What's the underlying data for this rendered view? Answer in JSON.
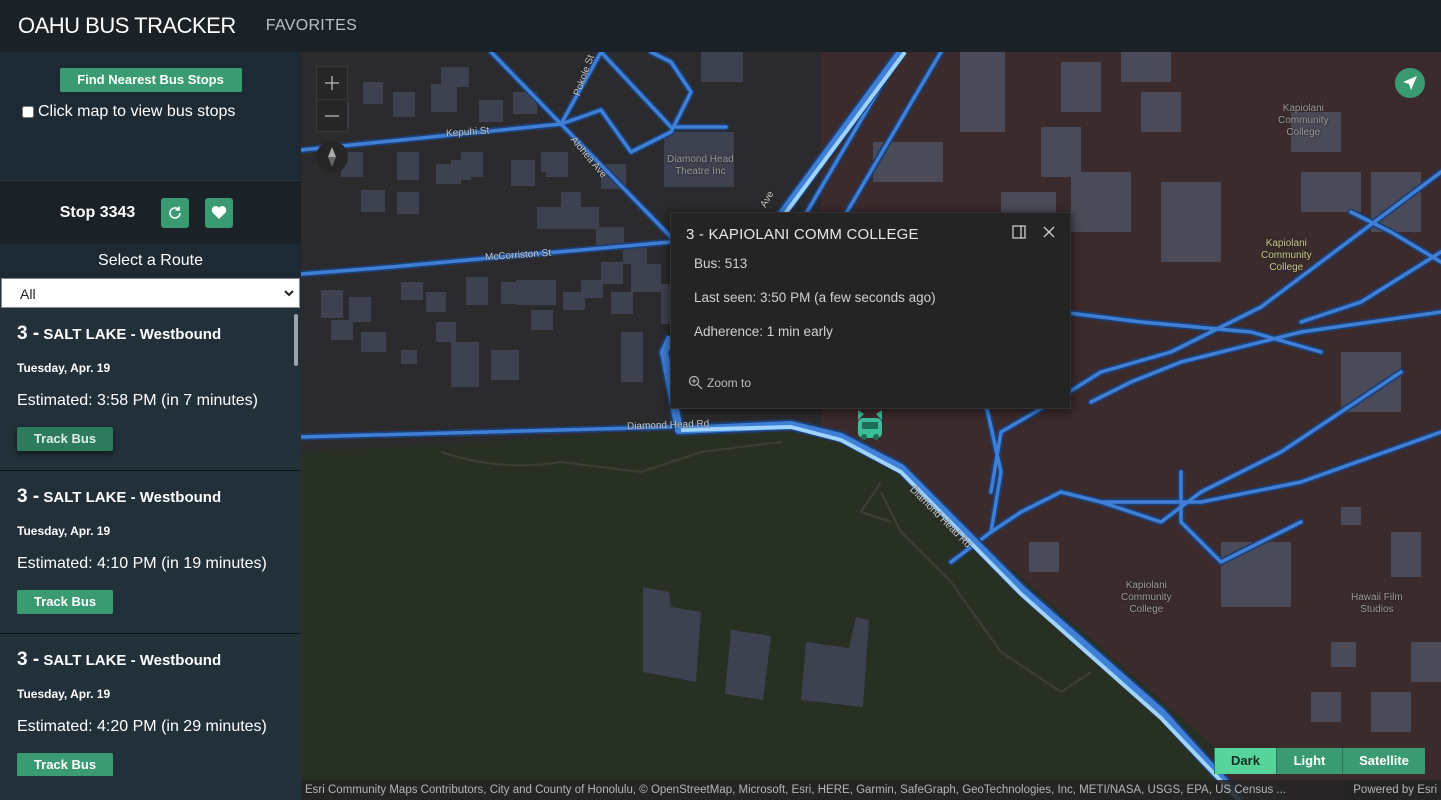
{
  "app": {
    "brand": "OAHU BUS TRACKER",
    "nav_favorites": "FAVORITES"
  },
  "sidebar": {
    "find_button": "Find Nearest Bus Stops",
    "click_map_label": "Click map to view bus stops",
    "stop_title": "Stop 3343",
    "select_route_label": "Select a Route",
    "route_select_value": "All",
    "arrivals": [
      {
        "route_num": "3 -",
        "route_name": "SALT LAKE - Westbound",
        "date": "Tuesday, Apr. 19",
        "estimate": "Estimated: 3:58 PM (in 7 minutes)",
        "button": "Track Bus"
      },
      {
        "route_num": "3 -",
        "route_name": "SALT LAKE - Westbound",
        "date": "Tuesday, Apr. 19",
        "estimate": "Estimated: 4:10 PM (in 19 minutes)",
        "button": "Track Bus"
      },
      {
        "route_num": "3 -",
        "route_name": "SALT LAKE - Westbound",
        "date": "Tuesday, Apr. 19",
        "estimate": "Estimated: 4:20 PM (in 29 minutes)",
        "button": "Track Bus"
      }
    ]
  },
  "map": {
    "popup": {
      "title": "3 - KAPIOLANI COMM COLLEGE",
      "bus": "Bus: 513",
      "last_seen": "Last seen: 3:50 PM (a few seconds ago)",
      "adherence": "Adherence: 1 min early",
      "zoom_to": "Zoom to"
    },
    "basemaps": [
      "Dark",
      "Light",
      "Satellite"
    ],
    "active_basemap": "Dark",
    "attribution": "Esri Community Maps Contributors, City and County of Honolulu, © OpenStreetMap, Microsoft, Esri, HERE, Garmin, SafeGraph, GeoTechnologies, Inc, METI/NASA, USGS, EPA, US Census ...",
    "powered_by": "Powered by Esri",
    "labels": {
      "kepuhi": "Kepuhi St",
      "pokole": "Pokole St",
      "alohea": "Alohea Ave",
      "mccorriston": "McCorriston St",
      "diamond_head_rd_1": "Diamond Head Rd",
      "diamond_head_rd_2": "Diamond Head Rd",
      "ave": "Ave",
      "theatre_1": "Diamond Head",
      "theatre_2": "Theatre Inc",
      "kcc_a1": "Kapiolani",
      "kcc_a2": "Community",
      "kcc_a3": "College",
      "kcc_b1": "Kapiolani",
      "kcc_b2": "Community",
      "kcc_b3": "College",
      "kcc_c1": "Kapiolani",
      "kcc_c2": "Community",
      "kcc_c3": "College",
      "hfs_1": "Hawaii Film",
      "hfs_2": "Studios"
    },
    "colors": {
      "accent": "#3a9b73",
      "accent_active": "#55d49b",
      "route_line": "#9fd4ff",
      "road": "#3f7fd6"
    }
  }
}
